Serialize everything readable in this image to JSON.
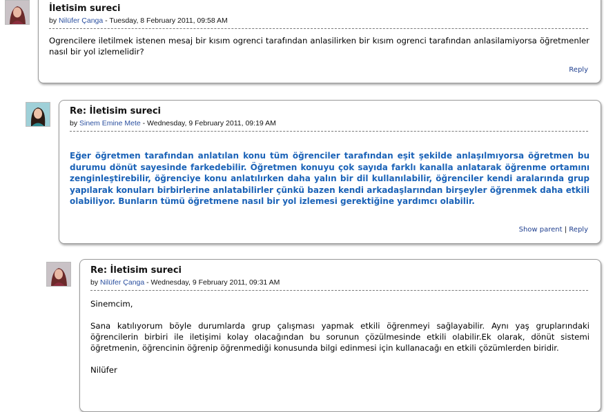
{
  "posts": [
    {
      "subject": "İletisim sureci",
      "by_prefix": "by",
      "author": "Nilüfer Çanga",
      "date_text": " - Tuesday, 8 February 2011, 09:58 AM",
      "paragraphs": [
        "Ogrencilere iletilmek istenen mesaj bir kısım ogrenci tarafından anlasilirken bir kısım ogrenci tarafından anlasilamiyorsa öğretmenler nasıl bir yol izlemelidir?"
      ],
      "reply": "Reply"
    },
    {
      "subject": "Re: İletisim sureci",
      "by_prefix": "by",
      "author": "Sinem Emine Mete",
      "date_text": " - Wednesday, 9 February 2011, 09:19 AM",
      "paragraphs": [
        "Eğer öğretmen tarafından anlatılan konu tüm öğrenciler tarafından eşit şekilde anlaşılmıyorsa öğretmen bu durumu dönüt sayesinde farkedebilir. Öğretmen konuyu çok sayıda farklı kanalla anlatarak öğrenme ortamını zenginleştirebilir, öğrenciye konu anlatılırken daha yalın bir dil kullanılabilir, öğrenciler kendi aralarında grup yapılarak konuları birbirlerine anlatabilirler çünkü bazen kendi arkadaşlarından birşeyler öğrenmek daha etkili olabiliyor. Bunların tümü öğretmene nasıl bir yol izlemesi gerektiğine yardımcı olabilir."
      ],
      "show_parent": "Show parent",
      "divider": "|",
      "reply": "Reply"
    },
    {
      "subject": "Re: İletisim sureci",
      "by_prefix": "by",
      "author": "Nilüfer Çanga",
      "date_text": " - Wednesday, 9 February 2011, 09:31 AM",
      "paragraphs": [
        "Sinemcim,",
        "Sana katılıyorum böyle durumlarda grup çalışması yapmak etkili öğrenmeyi sağlayabilir. Aynı yaş gruplarındaki öğrencilerin birbiri ile iletişimi kolay olacağından bu sorunun çözülmesinde etkili olabilir.Ek olarak, dönüt sistemi öğretmenin, öğrencinin öğrenip öğrenmediği konusunda bilgi edinmesi için kullanacağı en etkili çözümlerden biridir.",
        "Nilüfer"
      ]
    }
  ]
}
